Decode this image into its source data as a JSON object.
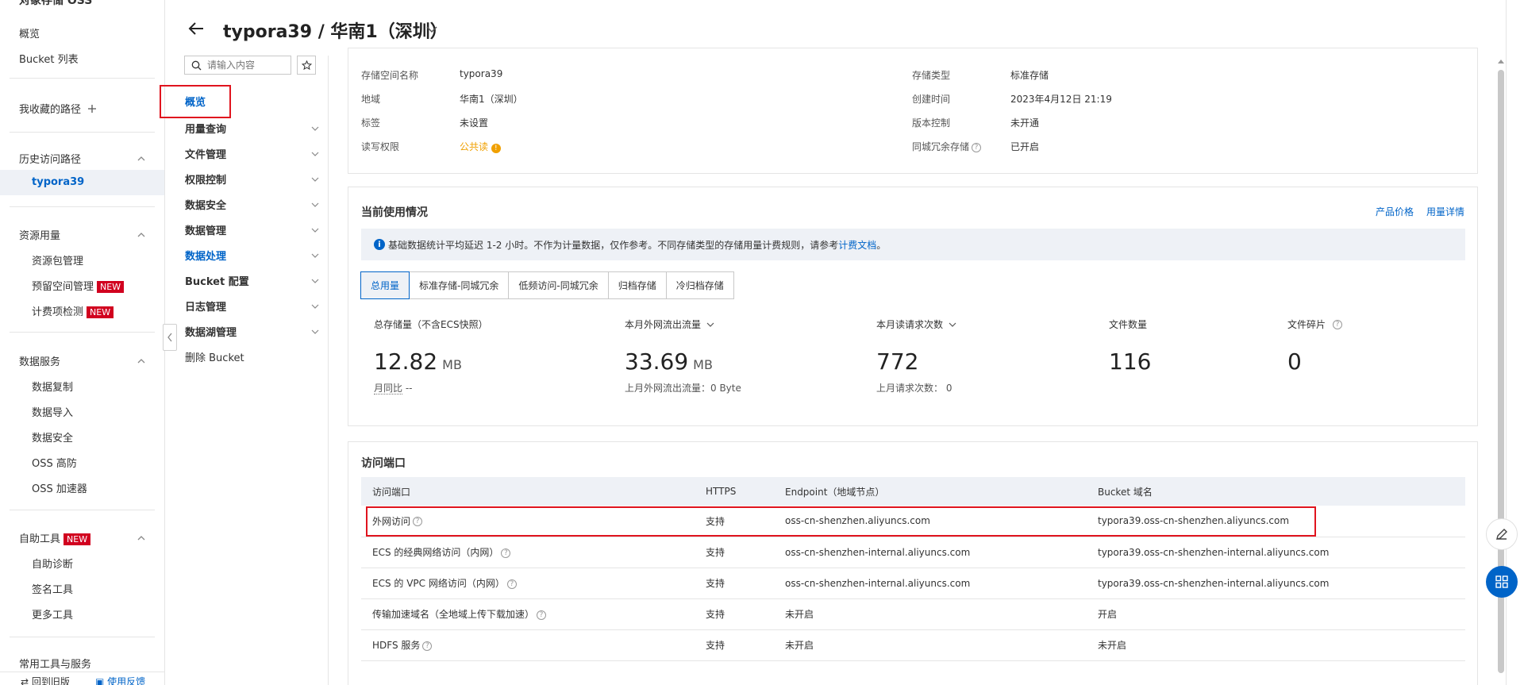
{
  "sidebar": {
    "title": "对象存储 OSS",
    "overview": "概览",
    "bucket_list": "Bucket 列表",
    "favorites": "我收藏的路径",
    "history": "历史访问路径",
    "history_active": "typora39",
    "resource": "资源用量",
    "resource_items": [
      "资源包管理",
      "预留空间管理",
      "计费项检测"
    ],
    "new_tag": "NEW",
    "data_service": "数据服务",
    "data_items": [
      "数据复制",
      "数据导入",
      "数据安全",
      "OSS 高防",
      "OSS 加速器"
    ],
    "self_tools": "自助工具",
    "tool_items": [
      "自助诊断",
      "签名工具",
      "更多工具"
    ],
    "common_tools": "常用工具与服务",
    "footer_back": "回到旧版",
    "footer_feedback": "使用反馈"
  },
  "header": {
    "title": "typora39 / 华南1（深圳）"
  },
  "bucket_nav": {
    "search_placeholder": "请输入内容",
    "items": [
      {
        "label": "概览"
      },
      {
        "label": "用量查询"
      },
      {
        "label": "文件管理"
      },
      {
        "label": "权限控制"
      },
      {
        "label": "数据安全"
      },
      {
        "label": "数据管理"
      },
      {
        "label": "数据处理"
      },
      {
        "label": "Bucket 配置"
      },
      {
        "label": "日志管理"
      },
      {
        "label": "数据湖管理"
      },
      {
        "label": "删除 Bucket"
      }
    ]
  },
  "basic_info": {
    "name_label": "存储空间名称",
    "name": "typora39",
    "region_label": "地域",
    "region": "华南1（深圳）",
    "tag_label": "标签",
    "tag": "未设置",
    "acl_label": "读写权限",
    "acl": "公共读",
    "class_label": "存储类型",
    "class": "标准存储",
    "created_label": "创建时间",
    "created": "2023年4月12日 21:19",
    "version_label": "版本控制",
    "version": "未开通",
    "redundancy_label": "同城冗余存储",
    "redundancy": "已开启"
  },
  "usage": {
    "title": "当前使用情况",
    "link_price": "产品价格",
    "link_detail": "用量详情",
    "notice_prefix": "基础数据统计平均延迟 1-2 小时。不作为计量数据，仅作参考。不同存储类型的存储用量计费规则，请参考",
    "notice_link": "计费文档",
    "notice_suffix": "。",
    "tabs": [
      "总用量",
      "标准存储-同城冗余",
      "低频访问-同城冗余",
      "归档存储",
      "冷归档存储"
    ],
    "metrics": {
      "storage_label": "总存储量（不含ECS快照）",
      "storage_value": "12.82",
      "storage_unit": "MB",
      "storage_sub_label": "月同比",
      "storage_sub": "--",
      "traffic_label": "本月外网流出流量",
      "traffic_value": "33.69",
      "traffic_unit": "MB",
      "traffic_sub": "上月外网流出流量：0 Byte",
      "requests_label": "本月读请求次数",
      "requests_value": "772",
      "requests_sub": "上月请求次数：  0",
      "files_label": "文件数量",
      "files_value": "116",
      "fragments_label": "文件碎片",
      "fragments_value": "0"
    }
  },
  "ports": {
    "title": "访问端口",
    "headers": [
      "访问端口",
      "HTTPS",
      "Endpoint（地域节点）",
      "Bucket 域名"
    ],
    "rows": [
      {
        "name": "外网访问",
        "https": "支持",
        "endpoint": "oss-cn-shenzhen.aliyuncs.com",
        "domain": "typora39.oss-cn-shenzhen.aliyuncs.com"
      },
      {
        "name": "ECS 的经典网络访问（内网）",
        "https": "支持",
        "endpoint": "oss-cn-shenzhen-internal.aliyuncs.com",
        "domain": "typora39.oss-cn-shenzhen-internal.aliyuncs.com"
      },
      {
        "name": "ECS 的 VPC 网络访问（内网）",
        "https": "支持",
        "endpoint": "oss-cn-shenzhen-internal.aliyuncs.com",
        "domain": "typora39.oss-cn-shenzhen-internal.aliyuncs.com"
      },
      {
        "name": "传输加速域名（全地域上传下载加速）",
        "https": "支持",
        "endpoint": "未开启",
        "domain": "开启"
      },
      {
        "name": "HDFS 服务",
        "https": "支持",
        "endpoint": "未开启",
        "domain": "未开启"
      }
    ]
  },
  "colors": {
    "accent": "#0064c8",
    "success": "#0a9a3e",
    "warning": "#f0a000",
    "highlight": "#e0141e"
  }
}
